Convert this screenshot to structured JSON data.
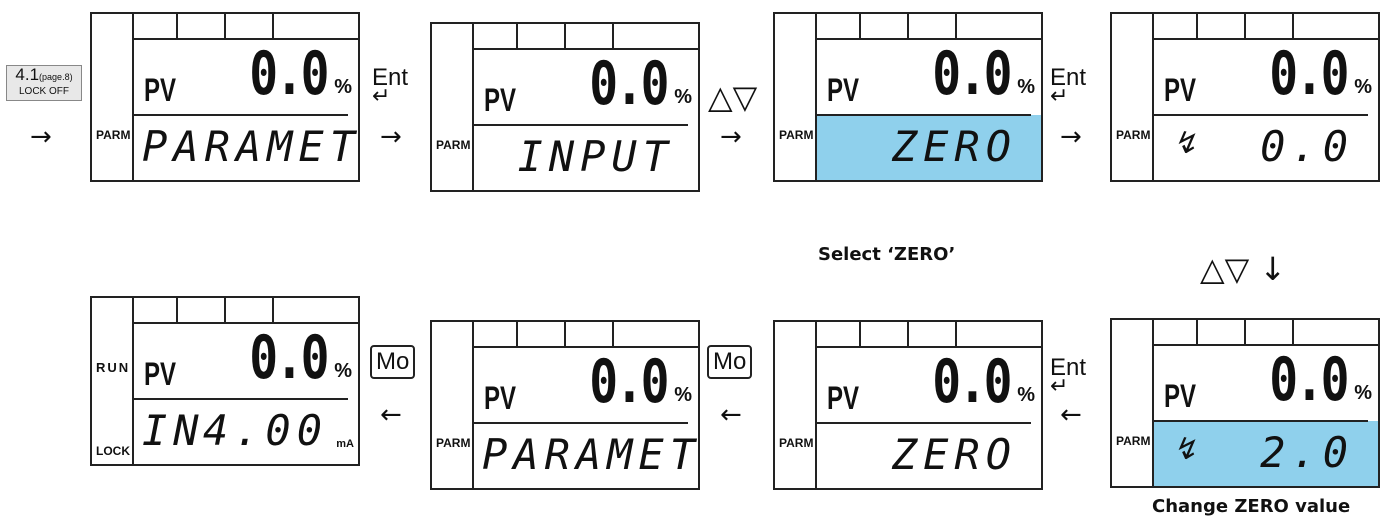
{
  "reference": {
    "section": "4.1",
    "page": "(page.8)",
    "state": "LOCK OFF"
  },
  "common": {
    "pv": "PV",
    "value": "0.0",
    "unit": "%",
    "mode_parm": "PARM"
  },
  "panels": [
    {
      "lower": "PARAMET"
    },
    {
      "lower": "INPUT"
    },
    {
      "lower": "ZERO"
    },
    {
      "lower": "0.0"
    },
    {
      "lower": "2.0"
    },
    {
      "lower": "ZERO"
    },
    {
      "lower": "PARAMET"
    },
    {
      "run": "RUN",
      "lock": "LOCK",
      "left": "IN",
      "right": "4.00",
      "unit": "mA"
    }
  ],
  "keys": {
    "ent": "Ent",
    "updown": "△▽",
    "updown_down": "△▽ ↓",
    "mo": "Mo"
  },
  "arrows": {
    "right": "→",
    "left": "←"
  },
  "captions": {
    "select_zero": "Select ‘ZERO’",
    "change_zero": "Change ZERO value"
  }
}
